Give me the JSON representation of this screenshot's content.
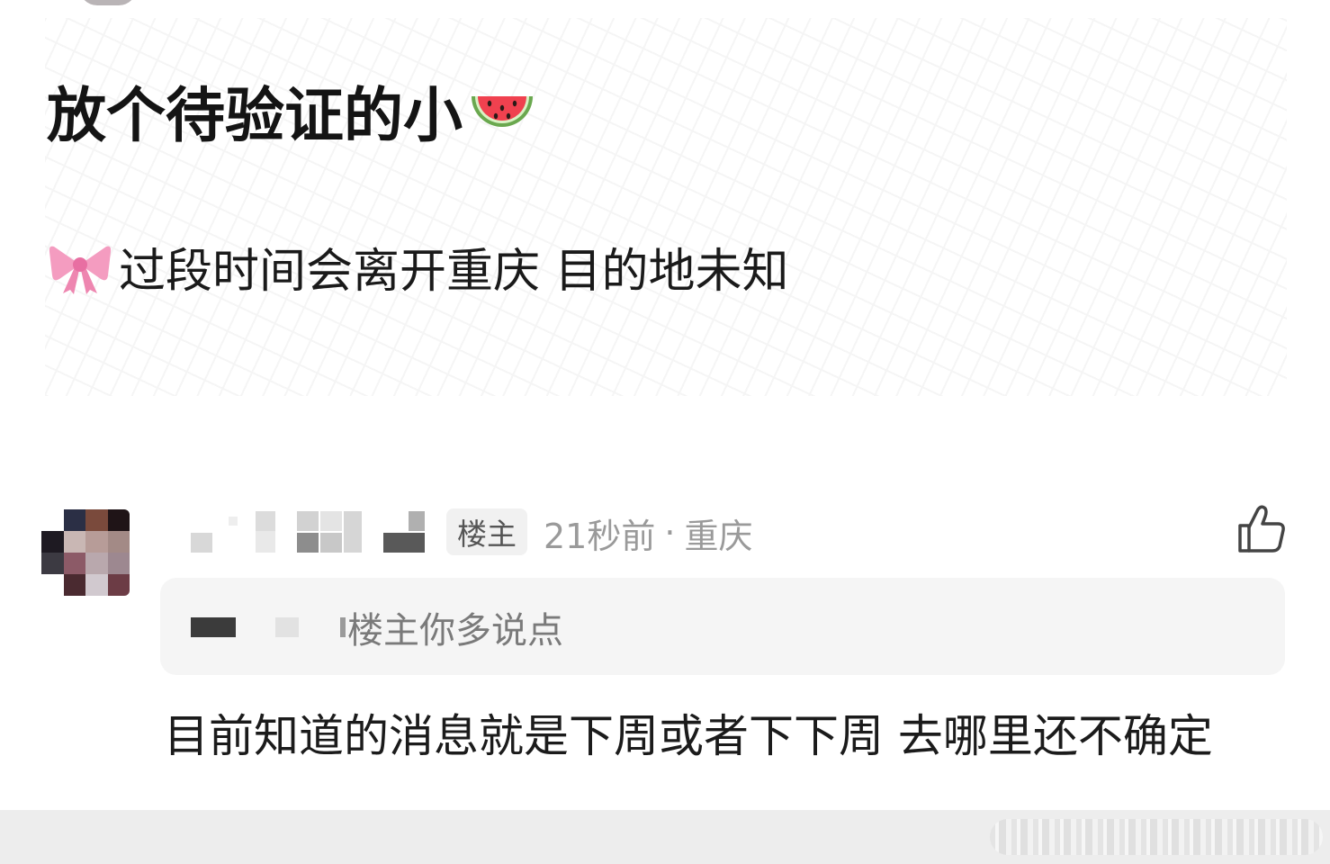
{
  "post": {
    "title_text": "放个待验证的小",
    "title_emoji": "watermelon",
    "body_emoji": "ribbon",
    "body_text": "过段时间会离开重庆 目的地未知"
  },
  "comment": {
    "op_badge": "楼主",
    "time": "21秒前",
    "separator": "·",
    "location": "重庆",
    "quote_text": "楼主你多说点",
    "reply_text": "目前知道的消息就是下周或者下下周 去哪里还不确定",
    "like_icon": "thumbs-up-icon"
  }
}
